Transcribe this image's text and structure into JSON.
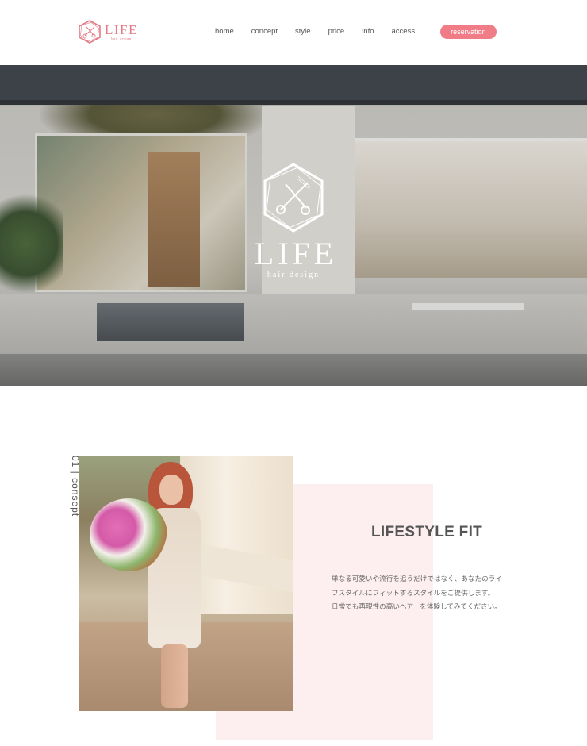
{
  "header": {
    "logo": {
      "name": "LIFE",
      "sub": "hair design"
    },
    "nav": [
      {
        "label": "home"
      },
      {
        "label": "concept"
      },
      {
        "label": "style"
      },
      {
        "label": "price"
      },
      {
        "label": "info"
      },
      {
        "label": "access"
      }
    ],
    "reservation_label": "reservation"
  },
  "hero": {
    "logo_name": "LIFE",
    "logo_sub": "hair design"
  },
  "concept": {
    "section_label": "01 | consept",
    "title": "LIFESTYLE FIT",
    "lines": [
      "単なる可愛いや流行を追うだけではなく、あなたのライ",
      "フスタイルにフィットするスタイルをご提供します。",
      "日常でも再現性の高いヘアーを体験してみてください。"
    ]
  },
  "colors": {
    "accent": "#ef7c87",
    "logo": "#e27a86",
    "pink_panel": "#fdeef0"
  }
}
